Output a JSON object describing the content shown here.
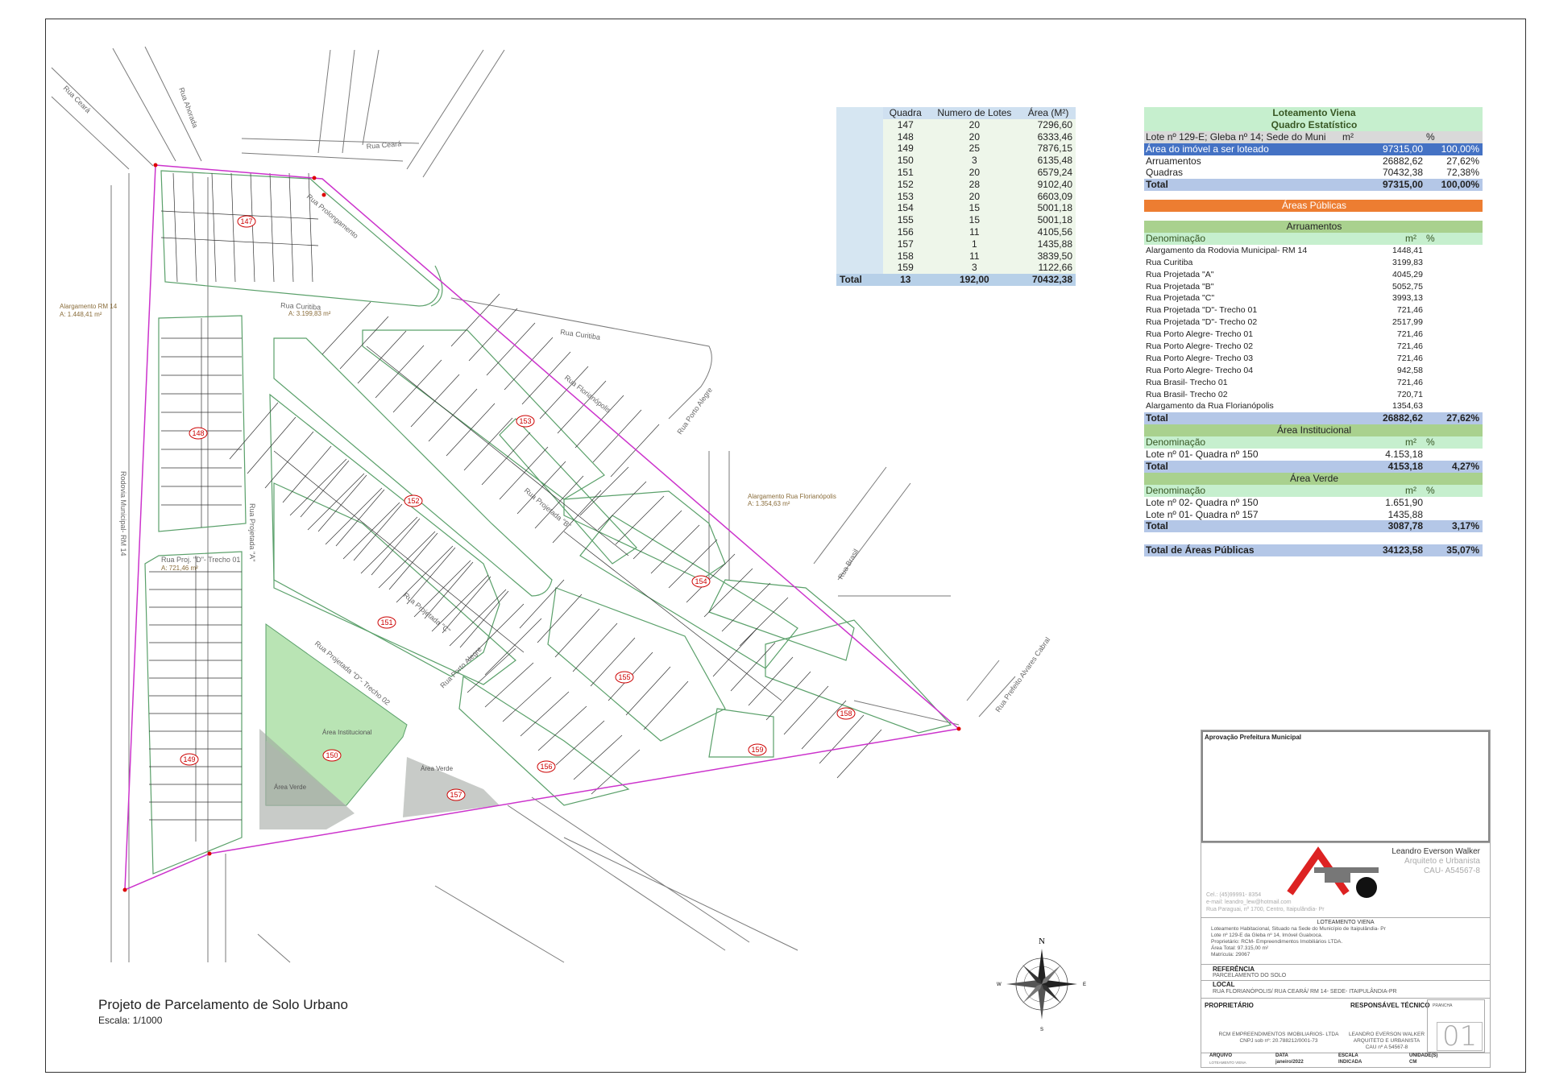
{
  "map": {
    "title": "Projeto de Parcelamento de Solo Urbano",
    "scale": "Escala: 1/1000",
    "street_labels": [
      "Rua Ceará",
      "Rua Ahorada",
      "Rua Ceará",
      "Rua Curitiba",
      "Rua Curitiba",
      "Rua Porto Alegre",
      "Rua Florianópolis",
      "Rua Brasil",
      "Rua Prolongamento",
      "Rodovia Municipal- RM 14",
      "Rua Projetada \"A\"",
      "Rua Proj. \"D\"- Trecho 01",
      "Rua Projetada \"B\"",
      "Rua Projetada \"C\"",
      "Rua Porto Alegre",
      "Rua Projetada \"D\"- Trecho 02",
      "Rua Prefeito Alvares Cabral"
    ],
    "area_labels": [
      "A: 3.199,83 m²",
      "A: 721,46 m²",
      "Alargamento RM 14",
      "A: 1.448,41 m²",
      "Alargamento Rua Florianópolis",
      "A: 1.354,63 m²",
      "Área Institucional",
      "Área Verde",
      "Área Verde"
    ],
    "block_numbers": [
      "147",
      "148",
      "149",
      "150",
      "151",
      "152",
      "153",
      "154",
      "155",
      "156",
      "157",
      "158",
      "159"
    ]
  },
  "quadras_table": {
    "headers": [
      "Quadra",
      "Numero de Lotes",
      "Área (M²)"
    ],
    "rows": [
      [
        "147",
        "20",
        "7296,60"
      ],
      [
        "148",
        "20",
        "6333,46"
      ],
      [
        "149",
        "25",
        "7876,15"
      ],
      [
        "150",
        "3",
        "6135,48"
      ],
      [
        "151",
        "20",
        "6579,24"
      ],
      [
        "152",
        "28",
        "9102,40"
      ],
      [
        "153",
        "20",
        "6603,09"
      ],
      [
        "154",
        "15",
        "5001,18"
      ],
      [
        "155",
        "15",
        "5001,18"
      ],
      [
        "156",
        "11",
        "4105,56"
      ],
      [
        "157",
        "1",
        "1435,88"
      ],
      [
        "158",
        "11",
        "3839,50"
      ],
      [
        "159",
        "3",
        "1122,66"
      ]
    ],
    "total": [
      "Total",
      "13",
      "192,00",
      "70432,38"
    ]
  },
  "stats": {
    "title1": "Loteamento Viena",
    "title2": "Quadro Estatístico",
    "lote_header": [
      "Lote nº 129-E; Gleba nº 14; Sede do Município",
      "m²",
      "%"
    ],
    "area_imovel": [
      "Área do imóvel a ser loteado",
      "97315,00",
      "100,00%"
    ],
    "arruamentos": [
      "Arruamentos",
      "26882,62",
      "27,62%"
    ],
    "quadras": [
      "Quadras",
      "70432,38",
      "72,38%"
    ],
    "total": [
      "Total",
      "97315,00",
      "100,00%"
    ],
    "areas_publicas": "Áreas Públicas",
    "arr_title": "Arruamentos",
    "denom_header": [
      "Denominação",
      "m²",
      "%"
    ],
    "arr_rows": [
      [
        "Alargamento da Rodovia Municipal- RM 14",
        "1448,41"
      ],
      [
        "Rua Curitiba",
        "3199,83"
      ],
      [
        "Rua Projetada \"A\"",
        "4045,29"
      ],
      [
        "Rua Projetada \"B\"",
        "5052,75"
      ],
      [
        "Rua Projetada \"C\"",
        "3993,13"
      ],
      [
        "Rua Projetada \"D\"- Trecho 01",
        "721,46"
      ],
      [
        "Rua Projetada \"D\"- Trecho 02",
        "2517,99"
      ],
      [
        "Rua Porto Alegre- Trecho 01",
        "721,46"
      ],
      [
        "Rua Porto Alegre- Trecho 02",
        "721,46"
      ],
      [
        "Rua Porto Alegre- Trecho 03",
        "721,46"
      ],
      [
        "Rua Porto Alegre- Trecho 04",
        "942,58"
      ],
      [
        "Rua Brasil- Trecho 01",
        "721,46"
      ],
      [
        "Rua Brasil- Trecho 02",
        "720,71"
      ],
      [
        "Alargamento da Rua Florianópolis",
        "1354,63"
      ]
    ],
    "arr_total": [
      "Total",
      "26882,62",
      "27,62%"
    ],
    "inst_title": "Área Institucional",
    "inst_rows": [
      [
        "Lote nº 01- Quadra nº 150",
        "4.153,18"
      ]
    ],
    "inst_total": [
      "Total",
      "4153,18",
      "4,27%"
    ],
    "verde_title": "Área Verde",
    "verde_rows": [
      [
        "Lote nº 02- Quadra nº 150",
        "1.651,90"
      ],
      [
        "Lote nº 01- Quadra nº 157",
        "1435,88"
      ]
    ],
    "verde_total": [
      "Total",
      "3087,78",
      "3,17%"
    ],
    "total_publicas": [
      "Total de Áreas Públicas",
      "34123,58",
      "35,07%"
    ]
  },
  "title_block": {
    "aprovacao": "Aprovação Prefeitura Municipal",
    "architect_name": "Leandro Everson Walker",
    "architect_role": "Arquiteto e Urbanista",
    "architect_cau": "CAU- A54567-8",
    "contact": [
      "Cel.: (45)99991- 8354",
      "e-mail: leandro_lew@hotmail.com",
      "Rua Paraguai, nº 1700, Centro, Itaipulândia- Pr"
    ],
    "project_name": "LOTEAMENTO VIENA",
    "project_lines": [
      "Loteamento Habitacional, Situado na Sede do Município de Itaipulândia- Pr",
      "Lote nº 129-E da Gleba nº 14, Imóvel Gualxoca.",
      "Proprietário: RCM- Empreendimentos Imobiliários LTDA.",
      "Área Total: 97.315,00 m²",
      "Matrícula: 29067"
    ],
    "referencia_label": "REFERÊNCIA",
    "referencia": "PARCELAMENTO DO SOLO",
    "local_label": "LOCAL",
    "local": "RUA FLORIANÓPOLIS/ RUA CEARÁ/ RM 14- SEDE- ITAIPULÂNDIA-PR",
    "proprietario_label": "PROPRIETÁRIO",
    "responsavel_label": "RESPONSÁVEL TÉCNICO",
    "prancha_label": "PRANCHA",
    "proprietario": [
      "RCM EMPREENDIMENTOS IMOBILIARIOS- LTDA",
      "CNPJ sob nº: 20.788212/0001-73"
    ],
    "responsavel": [
      "LEANDRO EVERSON WALKER",
      "ARQUITETO E URBANISTA",
      "CAU nº A 54567-8"
    ],
    "prancha": "01",
    "footer_labels": [
      "ARQUIVO",
      "DATA",
      "ESCALA",
      "UNIDADE(S)"
    ],
    "footer_values": [
      "LOTEAMENTO VIENA",
      "janeiro/2022",
      "INDICADA",
      "CM"
    ]
  },
  "compass": {
    "n": "N",
    "s": "S",
    "e": "E",
    "w": "W"
  }
}
